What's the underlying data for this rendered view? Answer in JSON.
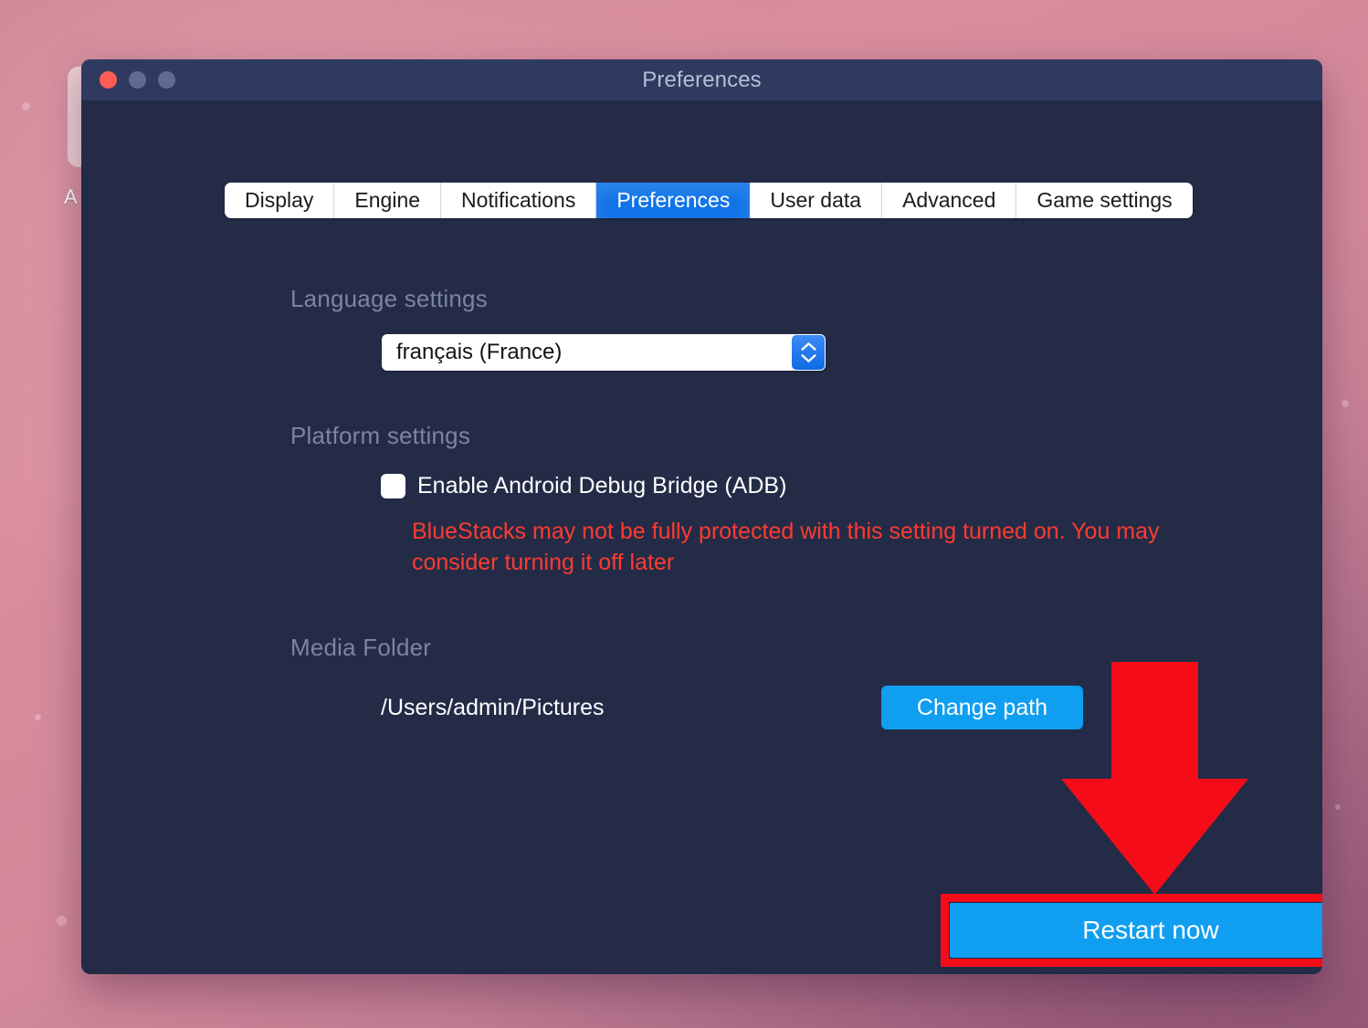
{
  "desktop": {
    "icon_label": "A"
  },
  "window": {
    "title": "Preferences",
    "traffic_lights": {
      "close": "close-button",
      "minimize": "minimize-button",
      "maximize": "maximize-button"
    }
  },
  "tabs": [
    {
      "label": "Display",
      "active": false
    },
    {
      "label": "Engine",
      "active": false
    },
    {
      "label": "Notifications",
      "active": false
    },
    {
      "label": "Preferences",
      "active": true
    },
    {
      "label": "User data",
      "active": false
    },
    {
      "label": "Advanced",
      "active": false
    },
    {
      "label": "Game settings",
      "active": false
    }
  ],
  "language": {
    "section_title": "Language settings",
    "selected": "français (France)"
  },
  "platform": {
    "section_title": "Platform settings",
    "adb_label": "Enable Android Debug Bridge (ADB)",
    "adb_checked": false,
    "warning": "BlueStacks may not be fully protected with this setting turned on. You may consider turning it off later"
  },
  "media": {
    "section_title": "Media Folder",
    "path": "/Users/admin/Pictures",
    "change_path_label": "Change path"
  },
  "footer": {
    "restart_label": "Restart now"
  },
  "colors": {
    "accent_blue": "#0f9ef0",
    "tab_active_blue": "#1073e8",
    "warning_red": "#ff3b30",
    "annotation_red": "#f40c18",
    "window_body": "#232b47",
    "titlebar": "#303a61",
    "section_label": "#7b84a3"
  }
}
